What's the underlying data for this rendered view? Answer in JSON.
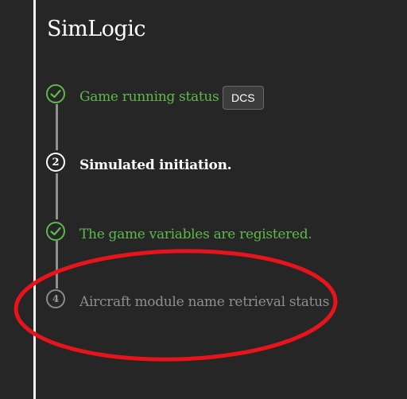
{
  "app": {
    "title": "SimLogic"
  },
  "steps": [
    {
      "number": "1",
      "state": "done",
      "label": "Game running status",
      "badge": "DCS"
    },
    {
      "number": "2",
      "state": "active",
      "label": "Simulated initiation."
    },
    {
      "number": "3",
      "state": "done",
      "label": "The game variables are registered."
    },
    {
      "number": "4",
      "state": "pending",
      "label": "Aircraft module name retrieval status"
    }
  ],
  "colors": {
    "background": "#262626",
    "done": "#5fb84a",
    "active": "#ffffff",
    "pending": "#8f8f8f",
    "annotation": "#e8141c"
  },
  "icons": {
    "done": "check-icon"
  }
}
